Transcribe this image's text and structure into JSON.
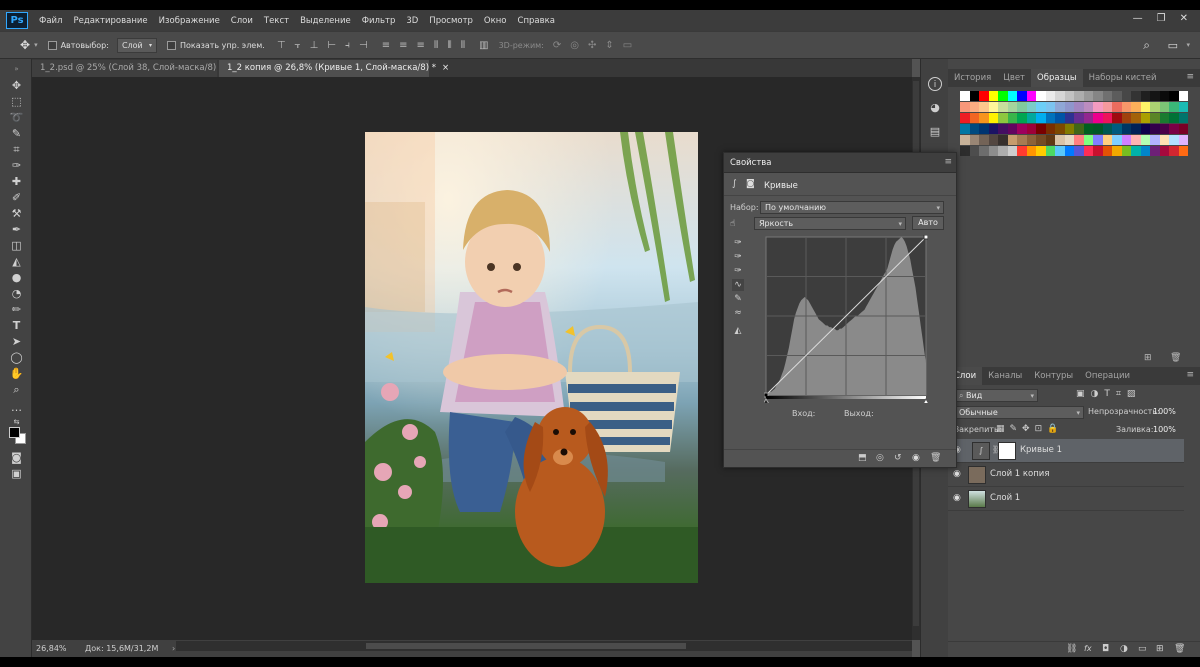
{
  "app": {
    "logo": "Ps"
  },
  "menu": [
    "Файл",
    "Редактирование",
    "Изображение",
    "Слои",
    "Текст",
    "Выделение",
    "Фильтр",
    "3D",
    "Просмотр",
    "Окно",
    "Справка"
  ],
  "window_controls": {
    "minimize": "—",
    "restore": "❐",
    "close": "✕"
  },
  "options_bar": {
    "autoselect_label": "Автовыбор:",
    "autoselect_value": "Слой",
    "show_controls_label": "Показать упр. элем.",
    "mode_3d_label": "3D-режим:"
  },
  "tabs": [
    {
      "label": "1_2.psd @ 25% (Слой 38, Слой-маска/8) *",
      "active": false
    },
    {
      "label": "1_2 копия @ 26,8% (Кривые 1, Слой-маска/8) *",
      "active": true
    }
  ],
  "status": {
    "zoom": "26,84%",
    "doc": "Док: 15,6M/31,2M"
  },
  "right_panel": {
    "top_tabs": [
      "История",
      "Цвет",
      "Образцы",
      "Наборы кистей"
    ],
    "active_top_tab": "Образцы",
    "layers_tabs": [
      "Слои",
      "Каналы",
      "Контуры",
      "Операции"
    ],
    "filter_label": "Вид",
    "blend_mode": "Обычные",
    "opacity_label": "Непрозрачность:",
    "opacity_value": "100%",
    "lock_label": "Закрепить:",
    "fill_label": "Заливка:",
    "fill_value": "100%",
    "layers": [
      {
        "name": "Кривые 1",
        "type": "adjustment",
        "selected": true,
        "visible": true
      },
      {
        "name": "Слой 1 копия",
        "type": "pixel",
        "selected": false,
        "visible": true
      },
      {
        "name": "Слой 1",
        "type": "pixel",
        "selected": false,
        "visible": true
      }
    ]
  },
  "properties": {
    "title": "Свойства",
    "subtitle": "Кривые",
    "preset_label": "Набор:",
    "preset_value": "По умолчанию",
    "channel_value": "Яркость",
    "auto_button": "Авто",
    "input_label": "Вход:",
    "output_label": "Выход:"
  },
  "swatch_colors": [
    [
      "#ffffff",
      "#000000",
      "#ff0000",
      "#ffff00",
      "#00ff00",
      "#00ffff",
      "#0000ff",
      "#ff00ff",
      "#ffffff",
      "#ebebeb",
      "#d6d6d6",
      "#c2c2c2",
      "#adadad",
      "#999999",
      "#858585",
      "#707070",
      "#5c5c5c",
      "#474747",
      "#333333",
      "#1f1f1f",
      "#141414",
      "#0a0a0a",
      "#000000",
      "#ffffff"
    ],
    [
      "#f7977a",
      "#fbad82",
      "#fdc68c",
      "#fff799",
      "#c6df9c",
      "#a4d49d",
      "#81ca9d",
      "#7bcdc8",
      "#6ccff7",
      "#7cc4f0",
      "#8fa7d6",
      "#8f96cc",
      "#a286c0",
      "#bc8cbf",
      "#f49bc1",
      "#f5999d",
      "#ec6c5e",
      "#f7976a",
      "#fbaf5a",
      "#fff467",
      "#acd372",
      "#7cc576",
      "#3bb878",
      "#1abbb4"
    ],
    [
      "#ed1c24",
      "#f26522",
      "#f7941d",
      "#fff200",
      "#8dc73f",
      "#39b54a",
      "#00a651",
      "#00a99d",
      "#00aeef",
      "#0072bc",
      "#0054a6",
      "#2e3192",
      "#662d91",
      "#92278f",
      "#ec008c",
      "#ed145b",
      "#9e0b0f",
      "#a0410d",
      "#a36209",
      "#aba000",
      "#598527",
      "#1a7b30",
      "#007236",
      "#00746b"
    ],
    [
      "#0076a3",
      "#004a80",
      "#003471",
      "#1b1464",
      "#440e62",
      "#630460",
      "#9e005d",
      "#9e0039",
      "#790000",
      "#7b2e00",
      "#7d4900",
      "#827b00",
      "#406618",
      "#005e20",
      "#005826",
      "#005952",
      "#005b7f",
      "#003663",
      "#002157",
      "#0d004c",
      "#32004b",
      "#4b0049",
      "#7b0046",
      "#7a0026"
    ],
    [
      "#c7b299",
      "#998675",
      "#736357",
      "#534741",
      "#37302d",
      "#c69c6d",
      "#a67c52",
      "#8c6239",
      "#754c24",
      "#603913",
      "#d9c3a7",
      "#e5d8c3",
      "#ff8080",
      "#80ff80",
      "#8080ff",
      "#ffd080",
      "#80d0ff",
      "#d080ff",
      "#ffb3b3",
      "#b3ffb3",
      "#b3b3ff",
      "#ffe0b3",
      "#b3e0ff",
      "#e0b3ff"
    ],
    [
      "#2d2d2d",
      "#4d4d4d",
      "#6d6d6d",
      "#8d8d8d",
      "#adadad",
      "#cdcdcd",
      "#ff3b30",
      "#ff9500",
      "#ffcc00",
      "#4cd964",
      "#5ac8fa",
      "#007aff",
      "#5856d6",
      "#ff2d55",
      "#c8102e",
      "#e35205",
      "#f2a900",
      "#78be20",
      "#00b2a9",
      "#0085ca",
      "#6d2077",
      "#a6093d",
      "#d22630",
      "#ff6a13"
    ]
  ],
  "histogram": [
    1,
    1,
    2,
    2,
    3,
    4,
    6,
    8,
    10,
    13,
    16,
    20,
    25,
    30,
    36,
    42,
    48,
    52,
    55,
    58,
    60,
    61,
    62,
    61,
    60,
    58,
    56,
    54,
    52,
    50,
    48,
    47,
    46,
    45,
    44,
    44,
    43,
    43,
    42,
    42,
    41,
    41,
    42,
    42,
    43,
    44,
    45,
    46,
    47,
    48,
    49,
    50,
    50,
    51,
    52,
    53,
    54,
    56,
    58,
    60,
    62,
    64,
    66,
    68,
    70,
    72,
    74,
    76,
    78,
    80,
    84,
    88,
    92,
    95,
    97,
    98,
    99,
    100,
    99,
    97,
    94,
    90,
    86,
    80,
    74,
    68,
    60,
    52,
    44,
    36,
    28,
    20
  ]
}
